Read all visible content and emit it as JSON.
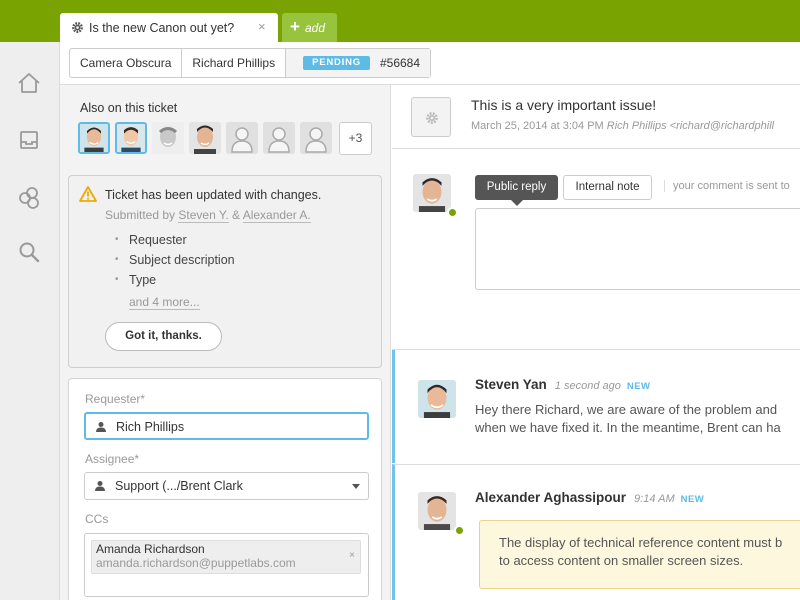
{
  "tabs": {
    "active": {
      "title": "Is the new Canon out yet?",
      "close": "×"
    },
    "add": {
      "plus": "+",
      "label": "add"
    }
  },
  "breadcrumb": {
    "org": "Camera Obscura",
    "user": "Richard Phillips",
    "status": "PENDING",
    "ticket_id": "#56684"
  },
  "also_on_ticket": {
    "title": "Also on this ticket",
    "more": "+3"
  },
  "notice": {
    "title": "Ticket has been updated with changes.",
    "submitted_prefix": "Submitted by",
    "submitter1": "Steven Y.",
    "amp": "&",
    "submitter2": "Alexander A.",
    "changes": [
      "Requester",
      "Subject description",
      "Type"
    ],
    "and_more": "and 4 more...",
    "button": "Got it, thanks."
  },
  "form": {
    "requester_label": "Requester*",
    "requester_value": "Rich Phillips",
    "assignee_label": "Assignee*",
    "assignee_value": "Support (.../Brent Clark",
    "ccs_label": "CCs",
    "cc_name": "Amanda Richardson",
    "cc_email": "amanda.richardson@puppetlabs.com",
    "cc_remove": "×"
  },
  "issue": {
    "title": "This is a very important issue!",
    "date": "March 25, 2014 at 3:04 PM",
    "author": "Rich Phillips <richard@richardphill"
  },
  "reply": {
    "public_label": "Public reply",
    "internal_label": "Internal note",
    "sent_note": "your comment is sent to"
  },
  "comments": [
    {
      "name": "Steven Yan",
      "time": "1 second ago",
      "badge": "NEW",
      "line1": "Hey there Richard, we are aware of the problem and",
      "line2": "when we have fixed it. In the meantime, Brent can ha"
    },
    {
      "name": "Alexander Aghassipour",
      "time": "9:14 AM",
      "badge": "NEW",
      "line1": "The display of technical reference content must b",
      "line2": "to access content on smaller screen sizes."
    }
  ],
  "colors": {
    "brand_green": "#78a300",
    "accent_blue": "#5ebbe6",
    "online_green": "#78a300"
  }
}
